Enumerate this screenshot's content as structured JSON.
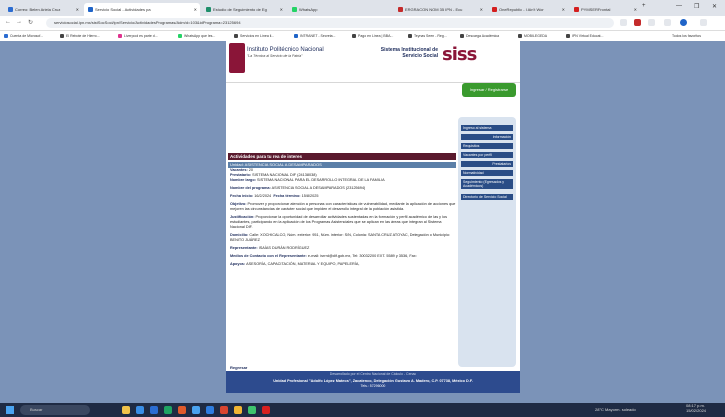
{
  "browser": {
    "tabs": [
      {
        "label": "Correo: Belen Ariela Cruz",
        "color": "#2b6cd1"
      },
      {
        "label": "Servicio Social - Actividades pa",
        "color": "#1f64c8"
      },
      {
        "label": "Estudio de Seguimiento de Eg",
        "color": "#1f8f6b"
      },
      {
        "label": "WhatsApp",
        "color": "#25d366"
      },
      {
        "label": "ERGRACON NOM 35 IPN - Ecu",
        "color": "#c42b2b"
      },
      {
        "label": "OneRepublic - I Ain't Wor",
        "color": "#d41f1f"
      },
      {
        "label": "PYMSERFrontal",
        "color": "#d41f1f"
      }
    ],
    "url": "serviciosocial.ipn.mx/sistSocSoci/ipn/Servicio/ActividadesProgramas/Adm/d=103&idPrograma=23125694",
    "bookmarks": [
      {
        "label": "Cuenta de Microsof...",
        "color": "#2b6cd1"
      },
      {
        "label": "El Rebote de Hierro...",
        "color": "#444"
      },
      {
        "label": "Liverpool es parte d...",
        "color": "#e0338f"
      },
      {
        "label": "WhatsApp que les...",
        "color": "#25d366"
      },
      {
        "label": "Servicios en Línea il...",
        "color": "#444"
      },
      {
        "label": "INTRANET - Secreta...",
        "color": "#1f64c8"
      },
      {
        "label": "Pago en Linea | BBA...",
        "color": "#444"
      },
      {
        "label": "Teynas Seen - Reg...",
        "color": "#444"
      },
      {
        "label": "Descarga Académica",
        "color": "#444"
      },
      {
        "label": "MOBILEGEDA",
        "color": "#444"
      },
      {
        "label": "IPN Virtual Educat...",
        "color": "#444"
      }
    ],
    "all_bookmarks_label": "Todos los favoritos"
  },
  "site": {
    "ipn_title": "Instituto Politécnico Nacional",
    "ipn_motto": "\"La Técnica al Servicio de la Patria\"",
    "sis_title": "Sistema Institucional de Servicio Social",
    "siss_logo": "siss",
    "ingresar_label": "Ingresar / Registrarse"
  },
  "content": {
    "section_title": "Actividades para tu rea de interes",
    "unidad": "Unidad: ASISTENCIA SOCIAL A DESAMPARADOS",
    "vacantes_label": "Vacantes:",
    "vacantes_value": "20",
    "prestatario_label": "Prestatario:",
    "prestatario_value": "SISTEMA NACIONAL DIF (24138038)",
    "nombre_largo_label": "Nombre largo:",
    "nombre_largo_value": "SISTEMA NACIONAL PARA EL DESARROLLO INTEGRAL DE LA FAMILIA",
    "nombre_programa_label": "Nombre del programa:",
    "nombre_programa_value": "ASISTENCIA SOCIAL A DESAMPARADOS (23125694)",
    "fecha_inicio_label": "Fecha inicio:",
    "fecha_inicio_value": "16/2/2024",
    "fecha_termino_label": "Fecha término:",
    "fecha_termino_value": "15/8/2025",
    "objetivo_label": "Objetivo:",
    "objetivo_value": "Promover y proporcionar atención a personas con características de vulnerabilidad, mediante la aplicación de acciones que mejoren las circunstancias de carácter social que impiden el desarrollo integral de la población asistida.",
    "justificacion_label": "Justificación:",
    "justificacion_value": "Proporcionar la oportunidad de desarrollar actividades sustentadas en la formación y perfil académico de las y los estudiantes, participando en la aplicación de los Programas Asistenciales que se aplican en las áreas que integran al Sistema Nacional DIF.",
    "domicilio_label": "Domicilio:",
    "domicilio_value": "Calle: XOCHICALCO, Núm. exterior: 951, Núm. interior: S/N, Colonia: SANTA CRUZ ATOYAC, Delegación o Municipio: BENITO JUÁREZ",
    "representante_label": "Representante:",
    "representante_value": "ISAÍAS DURÁN RODRÍGUEZ",
    "medios_label": "Medios de Contacto con el Representante:",
    "medios_value": "e-mail: isrrrd@dif.gob.mx, Tel: 30032200 EXT. 5589 y 3536, Fax:",
    "apoyos_label": "Apoyos:",
    "apoyos_value": "ASESORÍA, CAPACITACIÓN, MATERIAL Y EQUIPO, PAPELERÍA,",
    "regresar": "Regresar"
  },
  "sidebar": [
    "Ingreso al sistema",
    "Información",
    "Requisitos",
    "Vacantes por perfil",
    "Prestatarios",
    "Normatividad",
    "Seguimiento (Egresados y Académicos)",
    "Directorio de Servicio Social"
  ],
  "footer": {
    "line1": "Desarrollado por el Centro Nacional de Cálculo - Cenac",
    "line2": "Unidad Profesional \"Adolfo López Mateos\", Zacatenco, Delegación Gustavo A. Madero, C.P. 07738, México D.F.",
    "line3": "Tels.: 57296000"
  },
  "taskbar": {
    "search_label": "Buscar",
    "weather": "28°C  Mayorm. soleado",
    "time": "08:17 p.m.",
    "date": "15/02/2024"
  }
}
